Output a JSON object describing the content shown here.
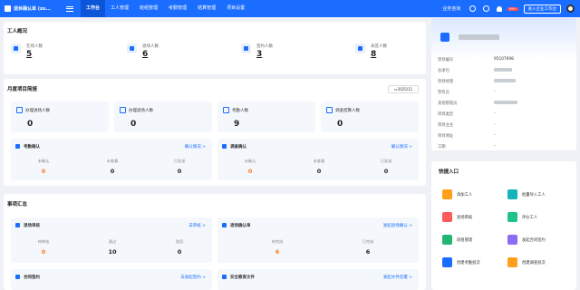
{
  "app": {
    "title": "退休确认单 (zo...",
    "nav": [
      "工作台",
      "工人管理",
      "班组管理",
      "考勤管理",
      "结算管理",
      "项目设置"
    ],
    "active_nav": "工作台",
    "help": "业务咨询",
    "badge": "99+",
    "switch_btn": "进入企业工作台"
  },
  "overview": {
    "title": "工人概况",
    "stats": [
      {
        "label": "在场人数",
        "value": "5",
        "icon": "users-icon"
      },
      {
        "label": "退场人数",
        "value": "6",
        "icon": "user-exit-icon"
      },
      {
        "label": "签约人数",
        "value": "3",
        "icon": "contract-icon"
      },
      {
        "label": "未签人数",
        "value": "8",
        "icon": "unsigned-icon"
      }
    ]
  },
  "monthly": {
    "title": "月度项目简报",
    "month": "2025/11",
    "cards": [
      {
        "label": "办理进场人数",
        "value": "0"
      },
      {
        "label": "办理退场人数",
        "value": "0"
      },
      {
        "label": "考勤人数",
        "value": "9"
      },
      {
        "label": "调查结算人数",
        "value": "0"
      }
    ],
    "attendance": {
      "title": "考勤确认",
      "link": "确认情况 >",
      "cols": [
        {
          "label": "未确认",
          "value": "0"
        },
        {
          "label": "未查看",
          "value": "0"
        },
        {
          "label": "已发送",
          "value": "0"
        }
      ]
    },
    "settlement": {
      "title": "调查确认",
      "link": "确认情况 >",
      "cols": [
        {
          "label": "未确认",
          "value": "0"
        },
        {
          "label": "未查看",
          "value": "0"
        },
        {
          "label": "已发送",
          "value": "0"
        }
      ]
    }
  },
  "tasks": {
    "title": "事项汇总",
    "exit_review": {
      "title": "退场审核",
      "link": "去审核 >",
      "cols": [
        {
          "label": "待审核",
          "value": "0"
        },
        {
          "label": "通过",
          "value": "10"
        },
        {
          "label": "驳回",
          "value": "0"
        }
      ]
    },
    "exit_confirm": {
      "title": "退场确认单",
      "link": "发起退场确认 >",
      "cols": [
        {
          "label": "待完成",
          "value": "6"
        },
        {
          "label": "已完成",
          "value": "6"
        }
      ]
    },
    "contract": {
      "title": "合同签约",
      "link": "去发起签约 >"
    },
    "safety": {
      "title": "安全教育文件",
      "link": "发起文件签署 >"
    }
  },
  "project": {
    "rows": [
      {
        "label": "项目编号",
        "value": "95107698"
      },
      {
        "label": "总承包",
        "value": ""
      },
      {
        "label": "项目经理",
        "value": ""
      },
      {
        "label": "劳务员",
        "value": "-"
      },
      {
        "label": "其他管理员",
        "value": ""
      },
      {
        "label": "项目类型",
        "value": "-"
      },
      {
        "label": "项目业主",
        "value": "-"
      },
      {
        "label": "项目地址",
        "value": "-"
      },
      {
        "label": "工期",
        "value": "-"
      }
    ]
  },
  "quick": {
    "title": "快捷入口",
    "items": [
      {
        "label": "添加工人",
        "color": "#ff9f1a"
      },
      {
        "label": "批量导入工人",
        "color": "#13b3b9"
      },
      {
        "label": "退场审核",
        "color": "#ff5a5a"
      },
      {
        "label": "评价工人",
        "color": "#1ec28b"
      },
      {
        "label": "班组管理",
        "color": "#22b573"
      },
      {
        "label": "发起合同签约",
        "color": "#8c6cf2"
      },
      {
        "label": "创建考勤批次",
        "color": "#1a6dff"
      },
      {
        "label": "创建调查批次",
        "color": "#ff9f1a"
      }
    ]
  }
}
